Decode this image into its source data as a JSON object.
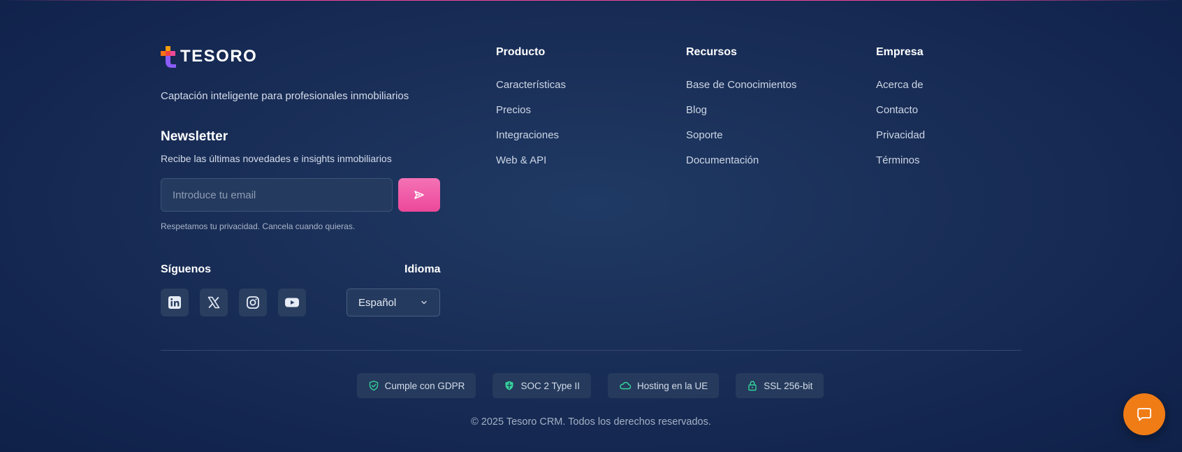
{
  "brand": {
    "name": "TESORO",
    "tagline": "Captación inteligente para profesionales inmobiliarios"
  },
  "newsletter": {
    "title": "Newsletter",
    "subtitle": "Recibe las últimas novedades e insights inmobiliarios",
    "email_placeholder": "Introduce tu email",
    "privacy_note": "Respetamos tu privacidad. Cancela cuando quieras."
  },
  "social": {
    "title": "Síguenos",
    "icons": [
      "linkedin-icon",
      "x-icon",
      "instagram-icon",
      "youtube-icon"
    ]
  },
  "language": {
    "title": "Idioma",
    "selected": "Español"
  },
  "columns": [
    {
      "title": "Producto",
      "links": [
        "Características",
        "Precios",
        "Integraciones",
        "Web & API"
      ]
    },
    {
      "title": "Recursos",
      "links": [
        "Base de Conocimientos",
        "Blog",
        "Soporte",
        "Documentación"
      ]
    },
    {
      "title": "Empresa",
      "links": [
        "Acerca de",
        "Contacto",
        "Privacidad",
        "Términos"
      ]
    }
  ],
  "badges": [
    {
      "label": "Cumple con GDPR",
      "icon": "shield-check-icon"
    },
    {
      "label": "SOC 2 Type II",
      "icon": "shield-icon"
    },
    {
      "label": "Hosting en la UE",
      "icon": "cloud-icon"
    },
    {
      "label": "SSL 256-bit",
      "icon": "lock-icon"
    }
  ],
  "copyright": "© 2025 Tesoro CRM. Todos los derechos reservados.",
  "colors": {
    "accent_pink": "#ec4899",
    "badge_icon_green": "#34d399",
    "chat_orange": "#f07c16",
    "background": "#1a2f58"
  }
}
